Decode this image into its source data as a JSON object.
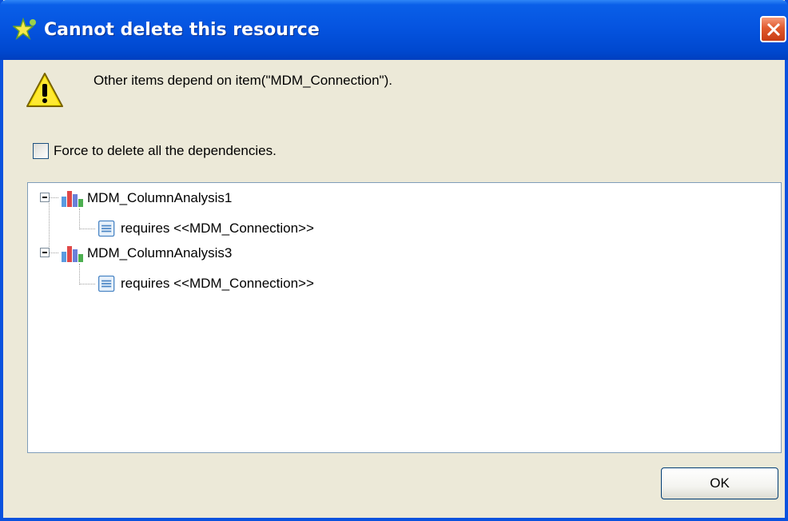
{
  "dialog": {
    "title": "Cannot delete this resource",
    "message": "Other items depend on item(\"MDM_Connection\").",
    "checkbox": {
      "label": "Force to delete all the dependencies.",
      "checked": false
    },
    "ok_label": "OK"
  },
  "tree": {
    "items": [
      {
        "label": "MDM_ColumnAnalysis1",
        "icon": "analysis-chart-icon",
        "children": [
          {
            "label": "requires <<MDM_Connection>>",
            "icon": "document-icon"
          }
        ]
      },
      {
        "label": "MDM_ColumnAnalysis3",
        "icon": "analysis-chart-icon",
        "children": [
          {
            "label": "requires <<MDM_Connection>>",
            "icon": "document-icon"
          }
        ]
      }
    ]
  },
  "colors": {
    "titlebar": "#0554e0",
    "frame": "#0a52de",
    "dialog_bg": "#ece9d8",
    "close": "#e15a2d"
  }
}
